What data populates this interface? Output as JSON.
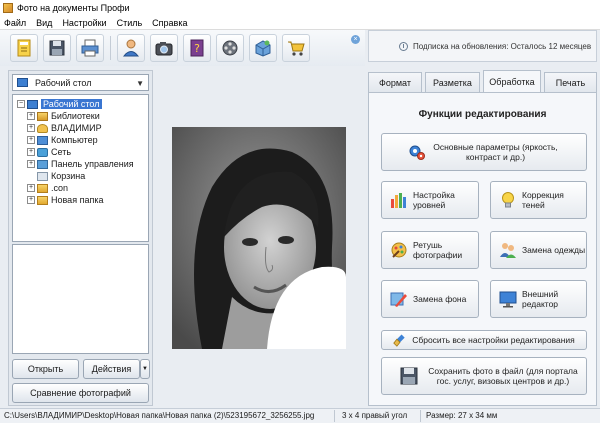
{
  "window": {
    "title": "Фото на документы Профи"
  },
  "menu": [
    "Файл",
    "Вид",
    "Настройки",
    "Стиль",
    "Справка"
  ],
  "toolbar": {
    "buttons": [
      "new-project-icon",
      "save-icon",
      "print-icon",
      "user-icon",
      "camera-icon",
      "help-icon",
      "video-icon",
      "package-icon",
      "cart-icon"
    ]
  },
  "subscription": {
    "text": "Подписка на обновления: Осталось 12 месяцев"
  },
  "left_panel": {
    "folder_select": "Рабочий стол",
    "tree": [
      {
        "label": "Рабочий стол",
        "icon": "desktop-icon",
        "level": 0,
        "expander": "−",
        "selected": true
      },
      {
        "label": "Библиотеки",
        "icon": "library-icon",
        "level": 1,
        "expander": "+"
      },
      {
        "label": "ВЛАДИМИР",
        "icon": "user-folder-icon",
        "level": 1,
        "expander": "+"
      },
      {
        "label": "Компьютер",
        "icon": "computer-icon",
        "level": 1,
        "expander": "+"
      },
      {
        "label": "Сеть",
        "icon": "network-icon",
        "level": 1,
        "expander": "+"
      },
      {
        "label": "Панель управления",
        "icon": "control-panel-icon",
        "level": 1,
        "expander": "+"
      },
      {
        "label": "Корзина",
        "icon": "recycle-bin-icon",
        "level": 1,
        "expander": ""
      },
      {
        "label": ".con",
        "icon": "folder-icon",
        "level": 1,
        "expander": "+"
      },
      {
        "label": "Новая папка",
        "icon": "folder-icon",
        "level": 1,
        "expander": "+"
      }
    ],
    "open_button": "Открыть",
    "actions_button": "Действия",
    "compare_button": "Сравнение фотографий"
  },
  "tabs": [
    {
      "label": "Формат",
      "active": false
    },
    {
      "label": "Разметка",
      "active": false
    },
    {
      "label": "Обработка",
      "active": true
    },
    {
      "label": "Печать",
      "active": false
    }
  ],
  "edit_panel": {
    "title": "Функции редактирования",
    "basic_params": "Основные параметры (яркость, контраст и др.)",
    "levels": "Настройка уровней",
    "shadows": "Коррекция теней",
    "retouch": "Ретушь фотографии",
    "clothes": "Замена одежды",
    "background": "Замена фона",
    "external": "Внешний редактор",
    "reset": "Сбросить все настройки редактирования",
    "save": "Сохранить фото в файл (для портала гос. услуг, визовых центров и др.)"
  },
  "status_bar": {
    "path": "C:\\Users\\ВЛАДИМИР\\Desktop\\Новая папка\\Новая папка (2)\\523195672_3256255.jpg",
    "format": "3 x 4 правый угол",
    "size": "Размер: 27 x 34 мм"
  }
}
